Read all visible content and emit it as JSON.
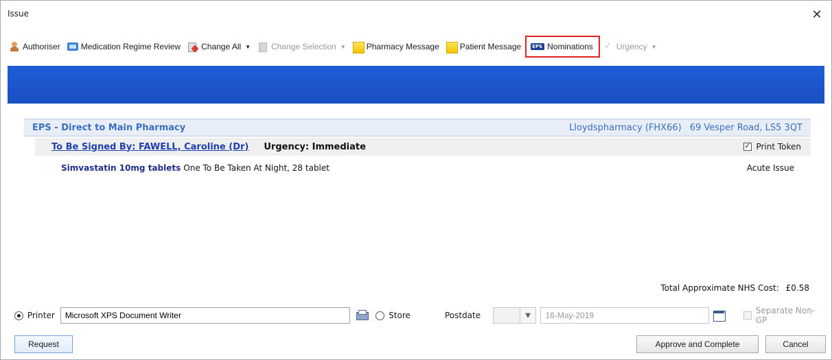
{
  "window": {
    "title": "Issue",
    "close_glyph": "✕"
  },
  "toolbar": {
    "items": [
      {
        "label": "Authoriser",
        "icon": "person-icon",
        "enabled": true,
        "dropdown": false
      },
      {
        "label": "Medication Regime Review",
        "icon": "review-icon",
        "enabled": true,
        "dropdown": false
      },
      {
        "label": "Change All",
        "icon": "change-icon",
        "enabled": true,
        "dropdown": true
      },
      {
        "label": "Change Selection",
        "icon": "change-selection-icon",
        "enabled": false,
        "dropdown": true
      },
      {
        "label": "Pharmacy Message",
        "icon": "note-icon",
        "enabled": true,
        "dropdown": false
      },
      {
        "label": "Patient Message",
        "icon": "note-icon",
        "enabled": true,
        "dropdown": false
      },
      {
        "label": "Nominations",
        "icon": "eps-icon",
        "enabled": true,
        "dropdown": false,
        "highlighted": true
      },
      {
        "label": "Urgency",
        "icon": "check-icon",
        "enabled": false,
        "dropdown": true
      }
    ]
  },
  "prescription": {
    "eps_label": "EPS - Direct to Main Pharmacy",
    "pharmacy": "Lloydspharmacy (FHX66)",
    "address": "69 Vesper Road, LS5 3QT",
    "signed_by": "To Be Signed By: FAWELL, Caroline (Dr)",
    "urgency": "Urgency: Immediate",
    "print_token_label": "Print Token",
    "print_token_checked": true,
    "medication": {
      "name": "Simvastatin 10mg tablets",
      "dosage": "One To Be Taken At Night, 28 tablet",
      "issue_type": "Acute Issue"
    },
    "total_label": "Total Approximate NHS Cost:",
    "total_value": "£0.58"
  },
  "output": {
    "printer_label": "Printer",
    "printer_selected": true,
    "printer_value": "Microsoft XPS Document Writer",
    "store_label": "Store",
    "store_selected": false,
    "postdate_label": "Postdate",
    "postdate_value": "16-May-2019",
    "separate_label": "Separate Non-GP",
    "separate_checked": false
  },
  "buttons": {
    "request": "Request",
    "approve": "Approve and Complete",
    "cancel": "Cancel"
  },
  "colors": {
    "banner": "#1e5ed6",
    "highlight_border": "#e0211f",
    "link": "#1f3fb0",
    "eps_text": "#3a6ec0"
  }
}
